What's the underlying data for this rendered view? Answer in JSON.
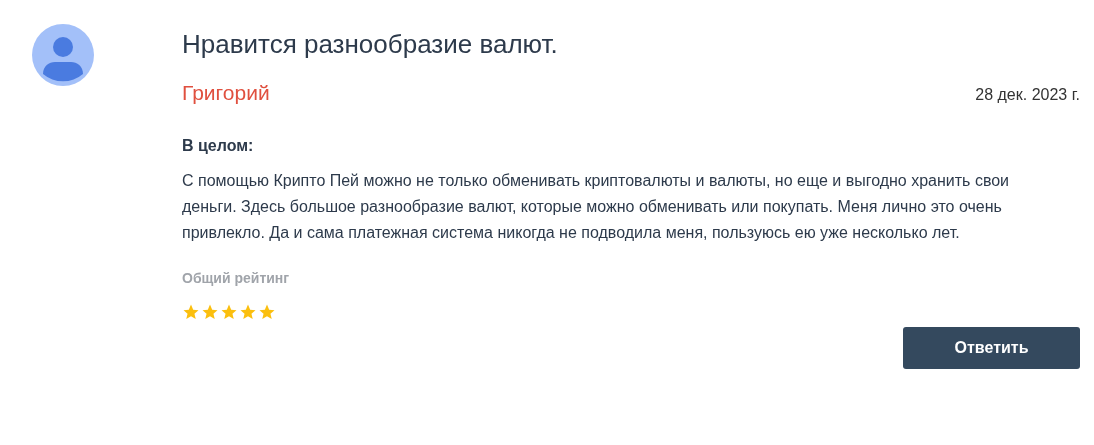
{
  "review": {
    "title": "Нравится разнообразие валют.",
    "author": "Григорий",
    "date": "28 дек. 2023 г.",
    "section_label": "В целом:",
    "text": "С помощью Крипто Пей можно не только обменивать криптовалюты и валюты, но еще и выгодно хранить свои деньги. Здесь большое разнообразие валют, которые можно обменивать или покупать. Меня лично это очень привлекло. Да и сама платежная система никогда не подводила меня, пользуюсь ею уже несколько лет.",
    "rating_label": "Общий рейтинг",
    "stars": 5
  },
  "buttons": [
    "Ответить"
  ]
}
